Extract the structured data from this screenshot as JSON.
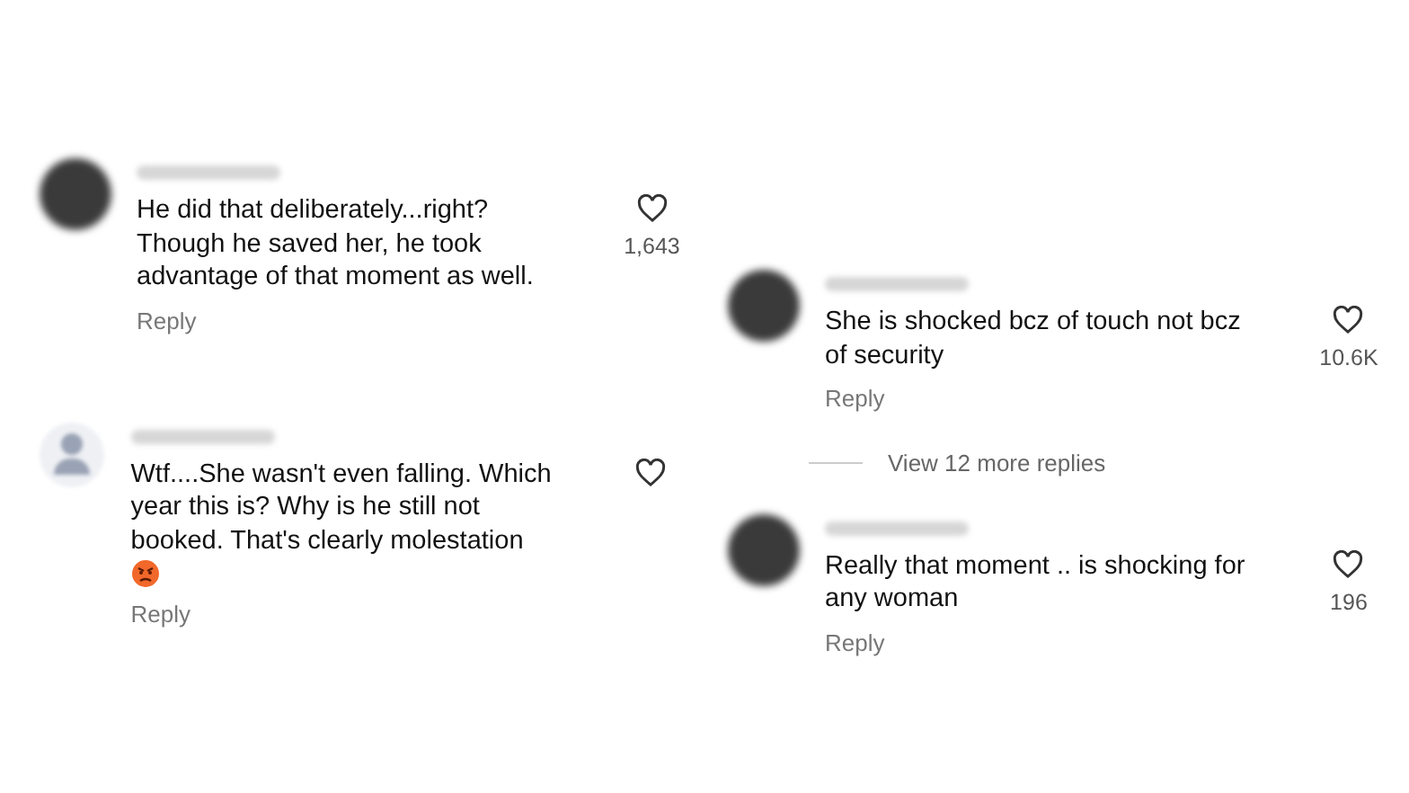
{
  "panels": [
    {
      "comments": [
        {
          "avatar": {
            "kind": "photo"
          },
          "text": "He did that deliberately...right? Though he saved her, he took advantage of that moment as well.",
          "likes": "1,643",
          "reply": "Reply",
          "emoji": false
        },
        {
          "avatar": {
            "kind": "default"
          },
          "text": "Wtf....She wasn't even falling. Which year this is? Why is he still not booked. That's clearly molestation",
          "reply": "Reply",
          "emoji": true
        }
      ]
    },
    {
      "comments": [
        {
          "avatar": {
            "kind": "photo"
          },
          "text": "She is shocked bcz of touch not bcz of security",
          "likes": "10.6K",
          "reply": "Reply",
          "emoji": false,
          "more_replies": "View 12 more replies"
        },
        {
          "avatar": {
            "kind": "photo"
          },
          "text": "Really that moment .. is shocking for any woman",
          "likes": "196",
          "reply": "Reply",
          "emoji": false
        }
      ]
    }
  ]
}
